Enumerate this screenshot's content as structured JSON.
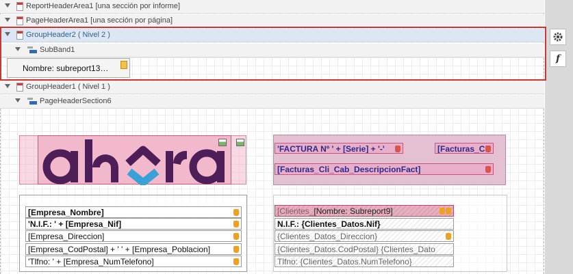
{
  "bands": {
    "report_header": "ReportHeaderArea1 [una sección por informe]",
    "page_header": "PageHeaderArea1 [una sección por página]",
    "group_header2": "GroupHeader2 ( Nivel 2 )",
    "subband": "SubBand1",
    "group_header1": "GroupHeader1 ( Nivel 1 )",
    "page_header_section": "PageHeaderSection6"
  },
  "subreport_label": "Nombre: subreport13…",
  "logo_text": "ahora",
  "invoice": {
    "title_field": "'FACTURA Nº ' + [Serie] + '-'",
    "number_field": "[Facturas_C",
    "description_field": "[Facturas_Cli_Cab_DescripcionFact]"
  },
  "company_fields": [
    "[Empresa_Nombre]",
    "'N.I.F.: ' + [Empresa_Nif]",
    "[Empresa_Direccion]",
    "[Empresa_CodPostal] + ' ' + [Empresa_Poblacion]",
    "'Tlfno: ' + [Empresa_NumTelefono]"
  ],
  "client_fields": {
    "name_placeholder": "[Clientes_",
    "name_overlay": "[Nombre: Subreport9]",
    "nif": "N.I.F.: {Clientes_Datos.Nif}",
    "address": "{Clientes_Datos_Direccion}",
    "postal": "{Clientes_Datos.CodPostal} {Clientes_Dato",
    "phone": "Tlfno: {Clientes_Datos.NumTelefono}"
  },
  "tools": {
    "settings_icon": "gear-icon",
    "function_label": "f"
  },
  "colors": {
    "selection": "#d0342c",
    "logo_purple": "#4e1e58",
    "logo_blue": "#3aa0d8",
    "band_pink": "#f2b8cc",
    "band_mauve": "#e3c1d2"
  }
}
